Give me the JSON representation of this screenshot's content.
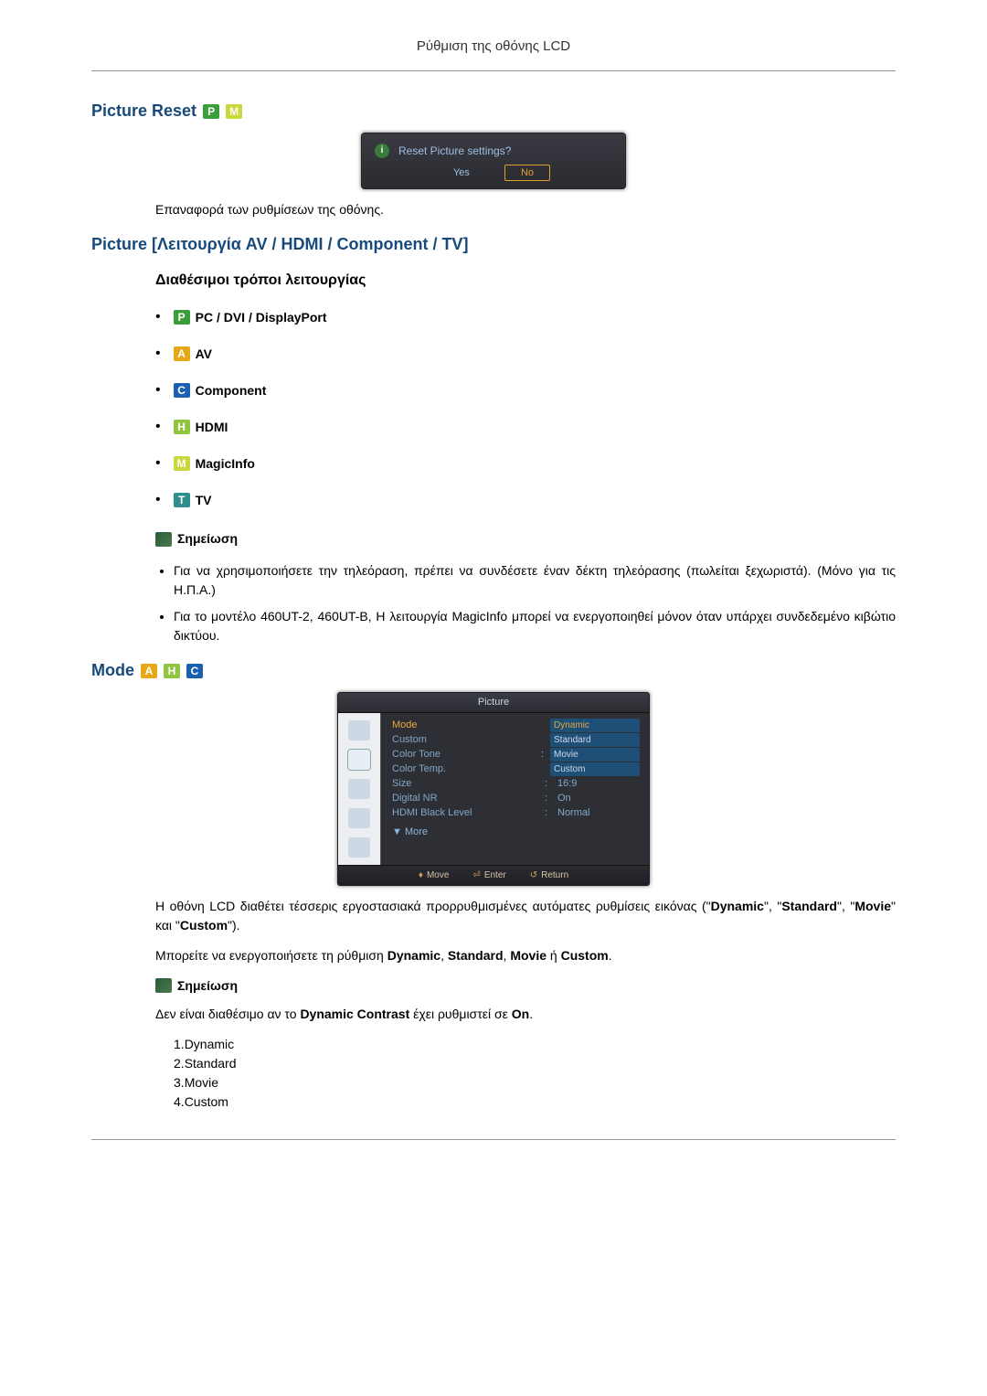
{
  "header_title": "Ρύθμιση της οθόνης LCD",
  "picture_reset": {
    "heading": "Picture Reset",
    "badges": [
      "P",
      "M"
    ],
    "dialog": {
      "question": "Reset Picture settings?",
      "yes": "Yes",
      "no": "No"
    },
    "desc": "Επαναφορά των ρυθμίσεων της οθόνης."
  },
  "picture_mode_section": {
    "heading": "Picture [Λειτουργία AV / HDMI / Component / TV]",
    "sub_heading": "Διαθέσιμοι τρόποι λειτουργίας",
    "modes": [
      {
        "badge": "P",
        "label": "PC / DVI / DisplayPort"
      },
      {
        "badge": "A",
        "label": "AV"
      },
      {
        "badge": "C",
        "label": "Component"
      },
      {
        "badge": "H",
        "label": "HDMI"
      },
      {
        "badge": "M",
        "label": "MagicInfo"
      },
      {
        "badge": "T",
        "label": "TV"
      }
    ],
    "note_label": "Σημείωση",
    "notes": [
      "Για να χρησιμοποιήσετε την τηλεόραση, πρέπει να συνδέσετε έναν δέκτη τηλεόρασης (πωλείται ξεχωριστά). (Μόνο για τις Η.Π.Α.)",
      "Για το μοντέλο 460UT-2, 460UT-B, Η λειτουργία MagicInfo μπορεί να ενεργοποιηθεί μόνον όταν υπάρχει συνδεδεμένο κιβώτιο δικτύου."
    ],
    "note_bold": "MagicInfo"
  },
  "mode_section": {
    "heading": "Mode",
    "badges": [
      "A",
      "H",
      "C"
    ],
    "osd": {
      "title": "Picture",
      "rows": {
        "mode": {
          "label": "Mode",
          "options": [
            "Dynamic",
            "Standard",
            "Movie",
            "Custom"
          ],
          "selected": "Dynamic"
        },
        "custom": {
          "label": "Custom"
        },
        "color_tone": {
          "label": "Color Tone"
        },
        "color_temp": {
          "label": "Color Temp."
        },
        "size": {
          "label": "Size",
          "value": "16:9"
        },
        "digital_nr": {
          "label": "Digital NR",
          "value": "On"
        },
        "hdmi_black": {
          "label": "HDMI Black Level",
          "value": "Normal"
        },
        "more": "More"
      },
      "footer": {
        "move": "Move",
        "enter": "Enter",
        "return": "Return"
      }
    },
    "desc1_a": "Η οθόνη LCD διαθέτει τέσσερις εργοστασιακά προρρυθμισμένες αυτόματες ρυθμίσεις εικόνας (\"",
    "desc1_b": "Dynamic",
    "desc1_c": "\", \"",
    "desc1_d": "Standard",
    "desc1_e": "\", \"",
    "desc1_f": "Movie",
    "desc1_g": "\" και \"",
    "desc1_h": "Custom",
    "desc1_i": "\").",
    "desc2_a": "Μπορείτε να ενεργοποιήσετε τη ρύθμιση ",
    "desc2_b": "Dynamic",
    "desc2_c": ", ",
    "desc2_d": "Standard",
    "desc2_e": ", ",
    "desc2_f": "Movie",
    "desc2_g": " ή ",
    "desc2_h": "Custom",
    "desc2_i": ".",
    "note_label": "Σημείωση",
    "note_text_a": "Δεν είναι διαθέσιμο αν το ",
    "note_text_b": "Dynamic Contrast",
    "note_text_c": " έχει ρυθμιστεί σε ",
    "note_text_d": "On",
    "note_text_e": ".",
    "list": [
      "Dynamic",
      "Standard",
      "Movie",
      "Custom"
    ]
  }
}
